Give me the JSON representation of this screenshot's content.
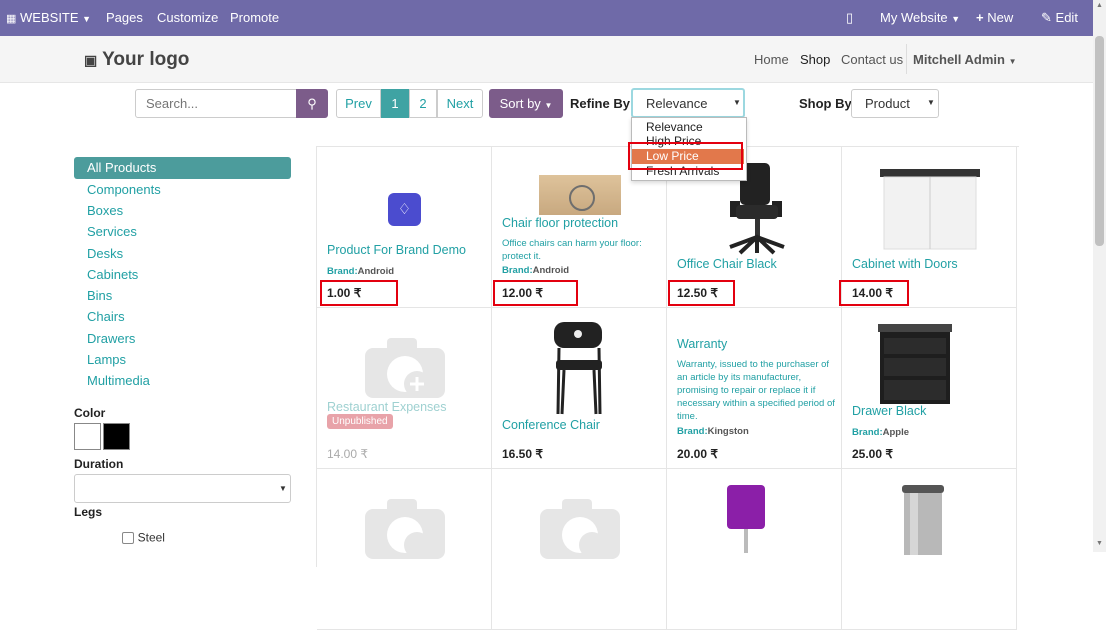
{
  "topbar": {
    "website": "WEBSITE",
    "pages": "Pages",
    "customize": "Customize",
    "promote": "Promote",
    "my_website": "My Website",
    "new": "New",
    "edit": "Edit"
  },
  "header": {
    "logo": "Your logo",
    "nav": [
      "Home",
      "Shop",
      "Contact us"
    ],
    "user": "Mitchell Admin"
  },
  "toolbar": {
    "search_placeholder": "Search...",
    "prev": "Prev",
    "pages": [
      "1",
      "2"
    ],
    "next": "Next",
    "sort_by": "Sort by",
    "refine_by": "Refine By",
    "refine_value": "Relevance",
    "shop_by": "Shop By",
    "shop_by_value": "Product"
  },
  "dropdown": {
    "options": [
      "Relevance",
      "High Price",
      "Low Price",
      "Fresh Arrivals"
    ],
    "highlighted": "Low Price"
  },
  "sidebar": {
    "categories": [
      "All Products",
      "Components",
      "Boxes",
      "Services",
      "Desks",
      "Cabinets",
      "Bins",
      "Chairs",
      "Drawers",
      "Lamps",
      "Multimedia"
    ],
    "color_label": "Color",
    "colors": [
      "#ffffff",
      "#000000"
    ],
    "duration_label": "Duration",
    "legs_label": "Legs",
    "legs_option": "Steel"
  },
  "products": [
    {
      "name": "Product For Brand Demo",
      "brand_label": "Brand:",
      "brand": "Android",
      "price": "1.00 ₹"
    },
    {
      "name": "Chair floor protection",
      "desc": "Office chairs can harm your floor: protect it.",
      "brand_label": "Brand:",
      "brand": "Android",
      "price": "12.00 ₹"
    },
    {
      "name": "Office Chair Black",
      "price": "12.50 ₹"
    },
    {
      "name": "Cabinet with Doors",
      "price": "14.00 ₹"
    },
    {
      "name": "Restaurant Expenses",
      "badge": "Unpublished",
      "price": "14.00 ₹"
    },
    {
      "name": "Conference Chair",
      "price": "16.50 ₹"
    },
    {
      "name": "Warranty",
      "desc": "Warranty, issued to the purchaser of an article by its manufacturer, promising to repair or replace it if necessary within a specified period of time.",
      "brand_label": "Brand:",
      "brand": "Kingston",
      "price": "20.00 ₹"
    },
    {
      "name": "Drawer Black",
      "brand_label": "Brand:",
      "brand": "Apple",
      "price": "25.00 ₹"
    }
  ]
}
